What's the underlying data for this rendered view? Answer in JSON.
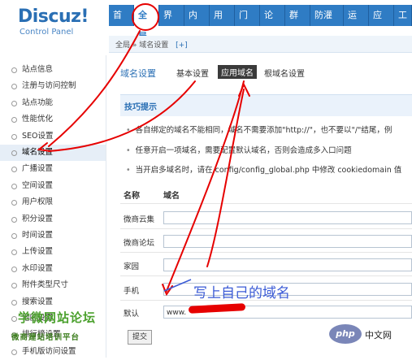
{
  "logo": {
    "title": "Discuz!",
    "subtitle": "Control Panel"
  },
  "nav": {
    "items": [
      "首页",
      "全局",
      "界面",
      "内容",
      "用户",
      "门户",
      "论坛",
      "群组",
      "防灌水",
      "运营",
      "应用",
      "工"
    ],
    "active_index": 1
  },
  "breadcrumb": {
    "text": "全局 » 域名设置",
    "add": "[+]"
  },
  "sidebar": {
    "items": [
      "站点信息",
      "注册与访问控制",
      "站点功能",
      "性能优化",
      "SEO设置",
      "域名设置",
      "广播设置",
      "空间设置",
      "用户权限",
      "积分设置",
      "时间设置",
      "上传设置",
      "水印设置",
      "附件类型尺寸",
      "搜索设置",
      "地区设置",
      "排行榜设置",
      "手机版访问设置"
    ],
    "active_index": 5
  },
  "tabs": {
    "title": "域名设置",
    "items": [
      "基本设置",
      "应用域名",
      "根域名设置"
    ],
    "active_index": 1
  },
  "tips": {
    "title": "技巧提示",
    "items": [
      "各自绑定的域名不能相同，域名不需要添加\"http://\"，也不要以\"/\"结尾，例",
      "任意开启一项域名，需要配置默认域名，否则会造成多入口问题",
      "当开启多域名时，请在 config/config_global.php 中修改 cookiedomain 值"
    ]
  },
  "table": {
    "headers": [
      "名称",
      "域名"
    ],
    "rows": [
      {
        "label": "微商云集",
        "value": ""
      },
      {
        "label": "微商论坛",
        "value": ""
      },
      {
        "label": "家园",
        "value": ""
      },
      {
        "label": "手机",
        "value": ""
      },
      {
        "label": "默认",
        "value": "www."
      }
    ]
  },
  "submit_label": "提交",
  "annotation": {
    "note": "写上自己的域名"
  },
  "watermark": {
    "line1": "学微网站论坛",
    "line2": "微商建站培训平台"
  },
  "badge": {
    "logo": "php",
    "text": "中文网"
  },
  "colors": {
    "nav_bg": "#2f7cc4",
    "annotation_red": "#e60000",
    "annotation_blue": "#3b5bd6"
  }
}
